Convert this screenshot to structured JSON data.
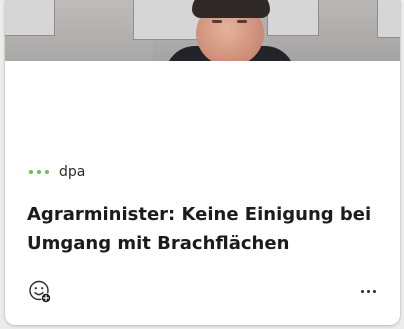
{
  "card": {
    "source": {
      "name": "dpa",
      "logo_icon": "dpa-dots-logo",
      "logo_color": "#6cc24a"
    },
    "headline": "Agrarminister: Keine Einigung bei Umgang mit Brachflächen",
    "image_icon": "news-photo",
    "actions": {
      "react_icon": "emoji-add-icon",
      "more_icon": "more-options-icon"
    }
  }
}
